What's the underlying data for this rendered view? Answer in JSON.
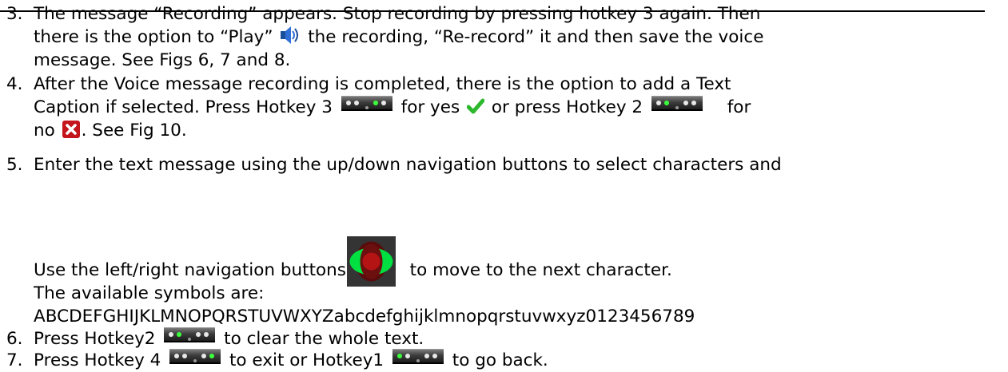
{
  "items": [
    {
      "num": "3.",
      "lines": [
        "The message “Recording” appears.  Stop recording by pressing hotkey 3 again.  Then",
        [
          "there is the option to “Play” ",
          " the recording, “Re-record” it and then save the voice"
        ],
        "message.  See Figs 6, 7 and 8."
      ]
    },
    {
      "num": "4.",
      "lines": [
        "After the Voice message recording is completed, there is the option to add a Text",
        [
          "Caption if selected.  Press Hotkey 3 ",
          " for yes ",
          " or press Hotkey 2 ",
          " for"
        ],
        [
          "no ",
          ". See Fig 10."
        ]
      ]
    },
    {
      "num": "5.",
      "lines": [
        "Enter the text message using the up/down navigation buttons to select characters and",
        [
          "Use the left/right navigation buttons ",
          " to move to the next character."
        ],
        "The available symbols are:",
        "ABCDEFGHIJKLMNOPQRSTUVWXYZabcdefghijklmnopqrstuvwxyz0123456789"
      ]
    },
    {
      "num": "6.",
      "lines": [
        [
          "Press Hotkey2 ",
          " to clear the whole text."
        ]
      ]
    },
    {
      "num": "7.",
      "lines": [
        [
          "Press Hotkey 4 ",
          " to exit or Hotkey1 ",
          " to go back."
        ]
      ]
    }
  ],
  "icons": {
    "speaker": "speaker-icon",
    "check": "green-checkmark-icon",
    "cross": "red-x-icon",
    "nav": "navigation-pad-icon",
    "hotkey": "hotkey-button-strip-icon"
  },
  "colors": {
    "hotkey_dot_active": "#3cff3c",
    "check": "#2eb82e",
    "cross": "#c4141c",
    "nav_active": "#00e040",
    "nav_center": "#b51414"
  }
}
